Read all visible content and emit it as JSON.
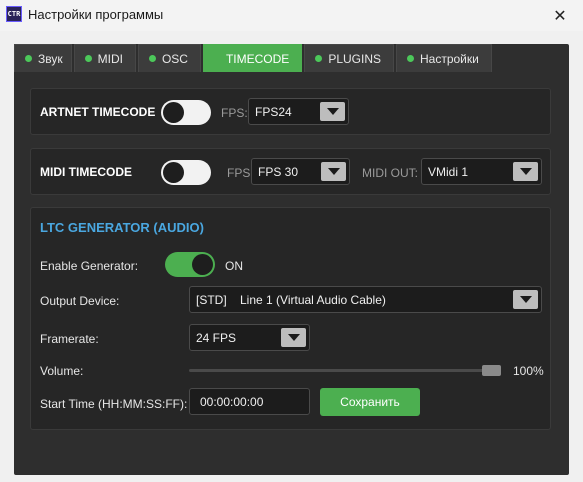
{
  "window": {
    "icon_text": "CTR",
    "title": "Настройки программы",
    "close_glyph": "✕"
  },
  "tabs": [
    {
      "label": "Звук",
      "active": false
    },
    {
      "label": "MIDI",
      "active": false
    },
    {
      "label": "OSC",
      "active": false
    },
    {
      "label": "TIMECODE",
      "active": true
    },
    {
      "label": "PLUGINS",
      "active": false
    },
    {
      "label": "Настройки",
      "active": false
    }
  ],
  "artnet": {
    "title": "ARTNET TIMECODE",
    "enabled": false,
    "fps_label": "FPS:",
    "fps_value": "FPS24"
  },
  "midi": {
    "title": "MIDI TIMECODE",
    "enabled": false,
    "fps_label": "FPS:",
    "fps_value": "FPS 30",
    "out_label": "MIDI OUT:",
    "out_value": "VMidi 1"
  },
  "ltc": {
    "title": "LTC GENERATOR (AUDIO)",
    "enable_label": "Enable Generator:",
    "enabled": true,
    "state_text": "ON",
    "output_label": "Output Device:",
    "output_value": "[STD]    Line 1 (Virtual Audio Cable)",
    "framerate_label": "Framerate:",
    "framerate_value": "24 FPS",
    "volume_label": "Volume:",
    "volume_percent": 100,
    "volume_text": "100%",
    "start_label": "Start Time (HH:MM:SS:FF):",
    "start_value": "00:00:00:00",
    "save_label": "Сохранить"
  },
  "colors": {
    "accent": "#4caf50",
    "ltc_title": "#4aa7e0",
    "panel_bg": "#262626",
    "window_bg": "#2e2e2e"
  }
}
